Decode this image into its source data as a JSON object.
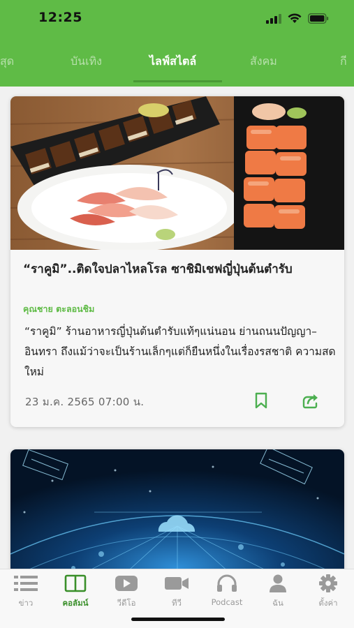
{
  "status_bar": {
    "time": "12:25"
  },
  "tabs": [
    {
      "label": "สุด"
    },
    {
      "label": "บันเทิง"
    },
    {
      "label": "ไลฟ์สไตล์"
    },
    {
      "label": "สังคม"
    },
    {
      "label": "กี"
    }
  ],
  "active_tab": "ไลฟ์สไตล์",
  "articles": [
    {
      "title": "“ราคูมิ”..ติดใจปลาไหลโรล ซาชิมิเชฟญี่ปุ่นต้นตำรับ",
      "author": "คุณชาย ตะลอนชิม",
      "summary": "“ราคูมิ” ร้านอาหารญี่ปุ่นต้นตำรับแท้ๆแน่นอน ย่านถนนปัญญา–อินทรา ถึงแม้ว่าจะเป็นร้านเล็กๆแต่ก็ยืนหนึ่งในเรื่องรสชาติ ความสดใหม่",
      "date": "23 ม.ค. 2565 07:00 น.",
      "image_icon": "sushi-photo"
    },
    {
      "image_icon": "network-satellite-photo"
    }
  ],
  "bottom_nav": [
    {
      "label": "ข่าว",
      "icon": "list-icon"
    },
    {
      "label": "คอลัมน์",
      "icon": "columns-icon"
    },
    {
      "label": "วีดีโอ",
      "icon": "play-icon"
    },
    {
      "label": "ทีวี",
      "icon": "video-camera-icon"
    },
    {
      "label": "Podcast",
      "icon": "headphones-icon"
    },
    {
      "label": "ฉัน",
      "icon": "user-icon"
    },
    {
      "label": "ตั้งค่า",
      "icon": "gear-icon"
    }
  ],
  "active_nav": "คอลัมน์",
  "colors": {
    "brand_green": "#5fbb46",
    "active_nav_green": "#3a8f2a",
    "accent_green": "#4caf50"
  }
}
